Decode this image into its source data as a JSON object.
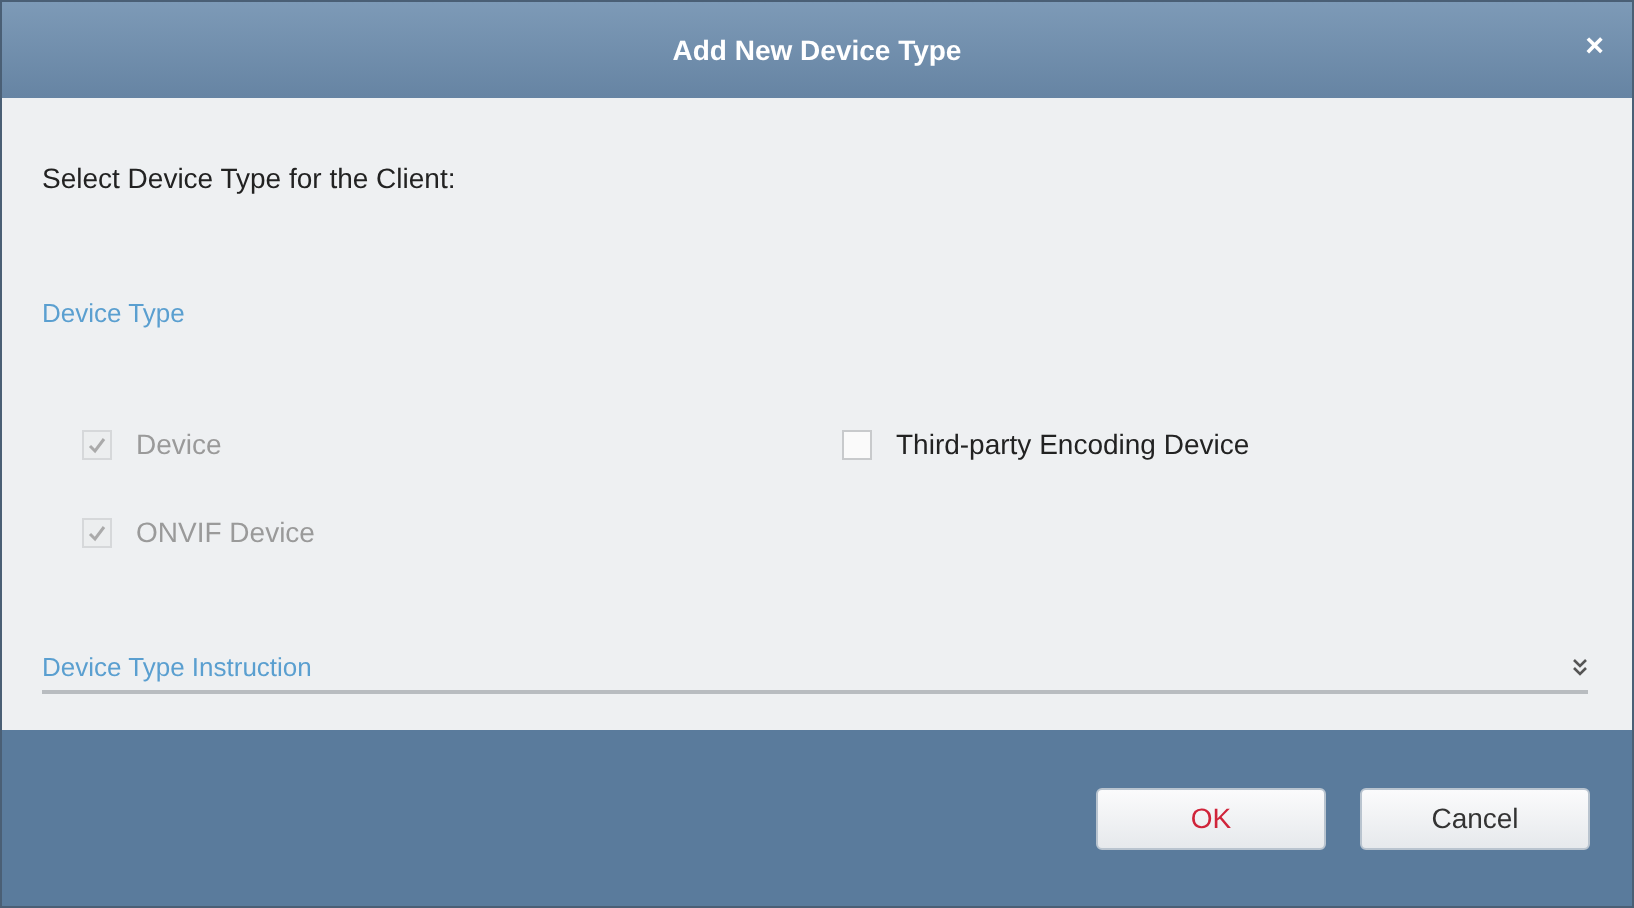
{
  "window": {
    "title": "Add New Device Type",
    "close": "×"
  },
  "prompt": "Select Device Type for the Client:",
  "device_type": {
    "heading": "Device Type",
    "options": [
      {
        "label": "Device",
        "checked": true,
        "disabled": true
      },
      {
        "label": "Third-party Encoding Device",
        "checked": false,
        "disabled": false
      },
      {
        "label": "ONVIF Device",
        "checked": true,
        "disabled": true
      }
    ]
  },
  "instruction": {
    "heading": "Device Type Instruction",
    "expanded": false
  },
  "buttons": [
    {
      "label": "OK",
      "kind": "primary"
    },
    {
      "label": "Cancel",
      "kind": "secondary"
    }
  ]
}
